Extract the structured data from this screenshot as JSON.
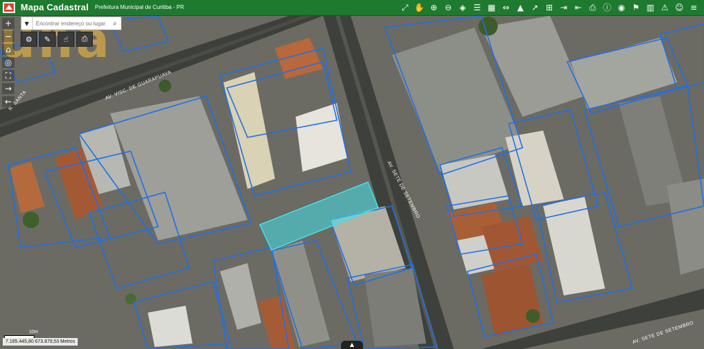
{
  "header": {
    "app_title": "Mapa Cadastral",
    "subtitle": "Prefeitura Municipal de Curitiba - PR"
  },
  "toolbar": {
    "tools": [
      {
        "name": "export-map-icon",
        "glyph": "⤢"
      },
      {
        "name": "pan-hand-icon",
        "glyph": "✋"
      },
      {
        "name": "zoom-in-icon",
        "glyph": "⊕"
      },
      {
        "name": "zoom-out-icon",
        "glyph": "⊖"
      },
      {
        "name": "layers-icon",
        "glyph": "◈"
      },
      {
        "name": "legend-icon",
        "glyph": "☰"
      },
      {
        "name": "grid-icon",
        "glyph": "▦"
      },
      {
        "name": "measure-icon",
        "glyph": "⇔"
      },
      {
        "name": "buildings-icon",
        "glyph": "▲"
      },
      {
        "name": "share-icon",
        "glyph": "↗"
      },
      {
        "name": "add-box-icon",
        "glyph": "⊞"
      },
      {
        "name": "exit-icon",
        "glyph": "⇥"
      },
      {
        "name": "login-icon",
        "glyph": "⇤"
      },
      {
        "name": "print-icon",
        "glyph": "⎙"
      },
      {
        "name": "info-icon",
        "glyph": "ⓘ"
      },
      {
        "name": "globe-icon",
        "glyph": "◉"
      },
      {
        "name": "analysis-icon",
        "glyph": "⚑"
      },
      {
        "name": "chart-icon",
        "glyph": "▥"
      },
      {
        "name": "alert-icon",
        "glyph": "⚠"
      },
      {
        "name": "user-icon",
        "glyph": "☺"
      },
      {
        "name": "menu-icon",
        "glyph": "≡"
      }
    ]
  },
  "left_tools": [
    {
      "name": "zoom-in-button-icon",
      "glyph": "+"
    },
    {
      "name": "zoom-out-button-icon",
      "glyph": "−"
    },
    {
      "name": "home-icon",
      "glyph": "⌂"
    },
    {
      "name": "locate-icon",
      "glyph": "◎"
    },
    {
      "name": "fullscreen-icon",
      "glyph": "⛶"
    },
    {
      "name": "next-extent-icon",
      "glyph": "→"
    },
    {
      "name": "previous-extent-icon",
      "glyph": "←"
    }
  ],
  "search": {
    "placeholder": "Encontrar endereço ou lugar",
    "value": ""
  },
  "map_tools": [
    {
      "name": "tool-settings-icon",
      "glyph": "⚙"
    },
    {
      "name": "tool-edit-icon",
      "glyph": "✎"
    },
    {
      "name": "tool-pointer-icon",
      "glyph": "☝"
    },
    {
      "name": "tool-print-icon",
      "glyph": "⎙"
    }
  ],
  "map": {
    "streets": [
      {
        "name": "street-label-guarapuava",
        "text": "AV. VISC. DE GUARAPUAVA"
      },
      {
        "name": "street-label-7-setembro-vertical",
        "text": "AV. SETE DE SETEMBRO"
      },
      {
        "name": "street-label-7-setembro-bottom",
        "text": "AV. SETE DE SETEMBRO"
      },
      {
        "name": "street-label-left",
        "text": "R. SANTA"
      }
    ],
    "highlight_color": "#43e0e8",
    "parcel_line_color": "#1f6fe8"
  },
  "scale": {
    "label": "10m"
  },
  "coordinates": {
    "text": "7.185.445,80 673.879,53 Metros"
  },
  "watermark": {
    "text": "una",
    "color": "#c9a24a"
  },
  "colors": {
    "header_bg": "#1e7a2e",
    "header_text": "#ffffff"
  }
}
